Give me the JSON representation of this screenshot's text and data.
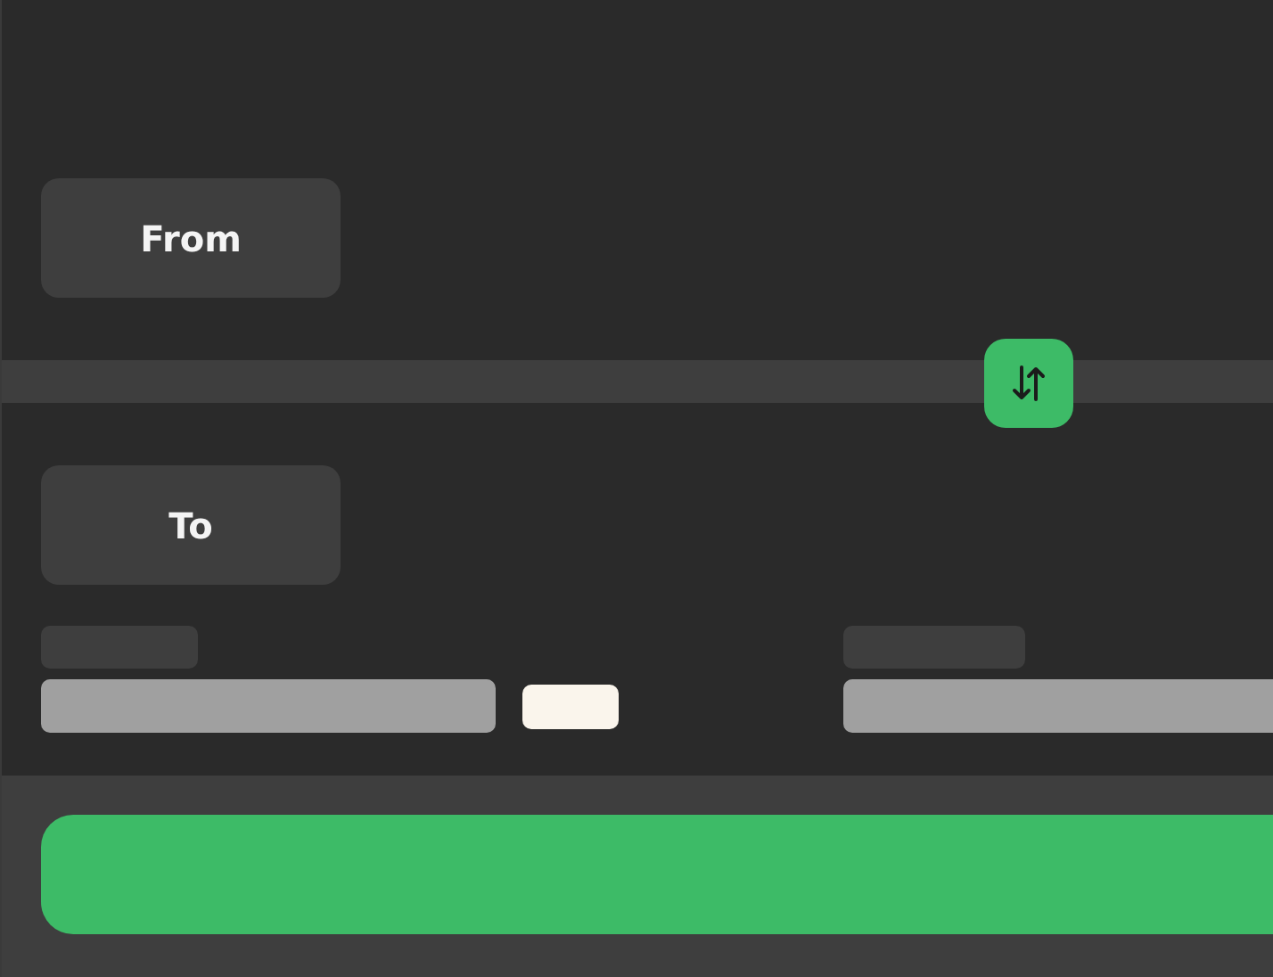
{
  "from_button": {
    "label": "From"
  },
  "to_button": {
    "label": "To"
  }
}
